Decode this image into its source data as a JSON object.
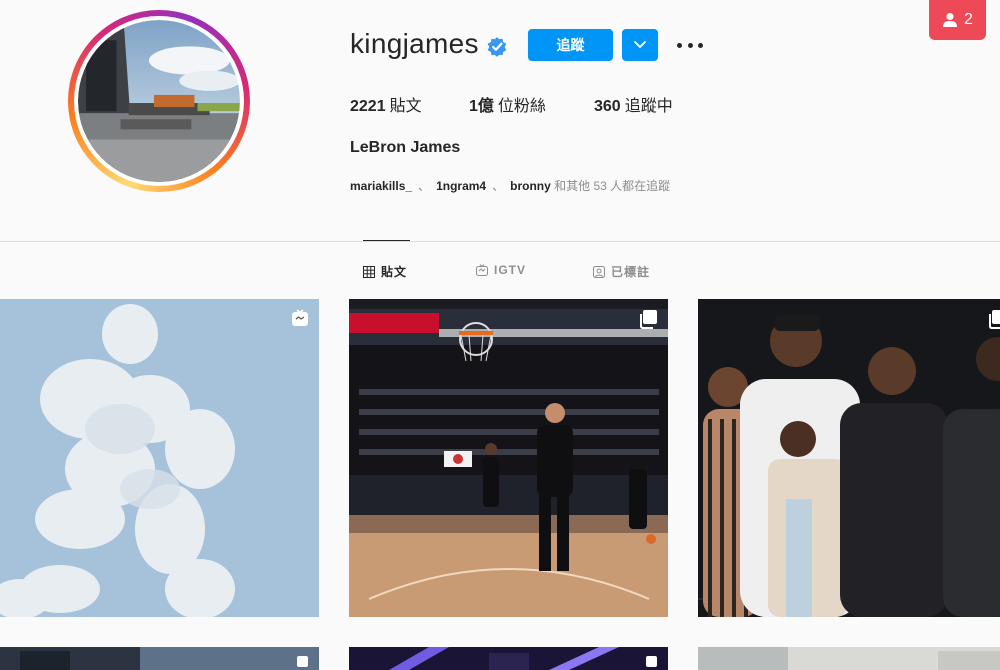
{
  "notification": {
    "count": "2",
    "icon": "person-icon",
    "color": "#ed4956"
  },
  "profile": {
    "username": "kingjames",
    "verified": true,
    "full_name": "LeBron James",
    "follow_label": "追蹤",
    "accent": "#0095f6"
  },
  "stats": {
    "posts": {
      "value": "2221",
      "label": "貼文"
    },
    "followers": {
      "value": "1億",
      "label": "位粉絲"
    },
    "following": {
      "value": "360",
      "label": "追蹤中"
    }
  },
  "followed_by": {
    "users": [
      "mariakills_",
      "1ngram4",
      "bronny"
    ],
    "separator": "、",
    "suffix": "和其他 53 人都在追蹤"
  },
  "tabs": [
    {
      "label": "貼文",
      "icon": "grid-icon",
      "active": true
    },
    {
      "label": "IGTV",
      "icon": "igtv-icon",
      "active": false
    },
    {
      "label": "已標註",
      "icon": "tagged-icon",
      "active": false
    }
  ],
  "posts": [
    {
      "alt": "clouds",
      "badge": "igtv-icon"
    },
    {
      "alt": "arena",
      "badge": "carousel-icon"
    },
    {
      "alt": "family",
      "badge": "carousel-icon"
    }
  ]
}
